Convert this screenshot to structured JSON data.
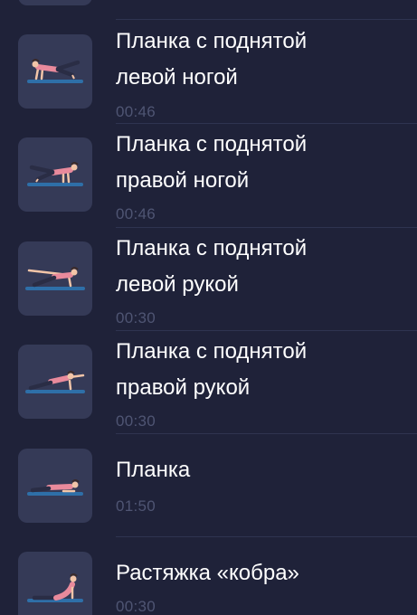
{
  "exercises": [
    {
      "title": "Планка с поднятой\nлевой ногой",
      "duration": "00:46",
      "icon": "plank-left-leg-raise-illustration"
    },
    {
      "title": "Планка с поднятой\nправой ногой",
      "duration": "00:46",
      "icon": "plank-right-leg-raise-illustration"
    },
    {
      "title": "Планка с поднятой\nлевой рукой",
      "duration": "00:30",
      "icon": "plank-left-arm-raise-illustration"
    },
    {
      "title": "Планка с поднятой\nправой рукой",
      "duration": "00:30",
      "icon": "plank-right-arm-raise-illustration"
    },
    {
      "title": "Планка",
      "duration": "01:50",
      "icon": "plank-illustration"
    },
    {
      "title": "Растяжка «кобра»",
      "duration": "00:30",
      "icon": "cobra-stretch-illustration"
    }
  ],
  "colors": {
    "background": "#1f2239",
    "thumb_background": "#353a57",
    "title_text": "#ffffff",
    "duration_text": "#4f5573",
    "mat": "#2e6fa8",
    "top_pink": "#e98a9c",
    "skin": "#f2c5a8",
    "pants": "#2a2d45"
  }
}
